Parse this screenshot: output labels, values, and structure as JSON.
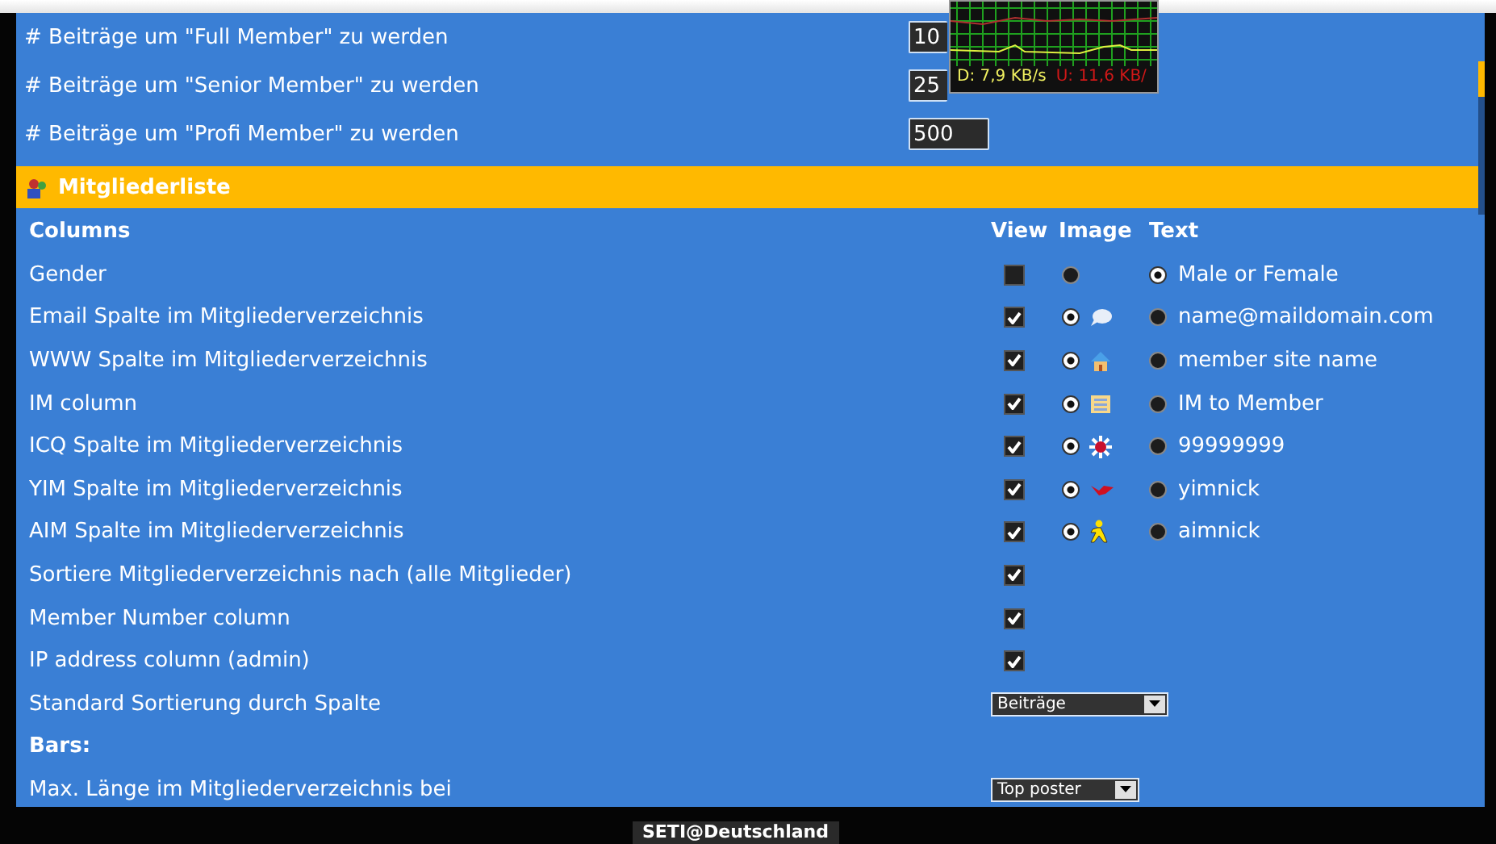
{
  "settings": [
    {
      "label": "# Beiträge um \"Full Member\" zu werden",
      "value": "10"
    },
    {
      "label": "# Beiträge um \"Senior Member\" zu werden",
      "value": "25"
    },
    {
      "label": "# Beiträge um \"Profi Member\" zu werden",
      "value": "500"
    }
  ],
  "network_monitor": {
    "download": "D: 7,9 KB/s",
    "upload": "U: 11,6 KB/"
  },
  "section": {
    "title": "Mitgliederliste"
  },
  "table": {
    "columns": [
      "Columns",
      "View",
      "Image",
      "Text"
    ],
    "rows": [
      {
        "kind": "options",
        "label": "Gender",
        "view_checked": false,
        "image_selected": false,
        "text_selected": true,
        "text": "Male or Female"
      },
      {
        "kind": "options",
        "label": "Email Spalte im Mitgliederverzeichnis",
        "view_checked": true,
        "image_selected": true,
        "text_selected": false,
        "text": "name@maildomain.com"
      },
      {
        "kind": "options",
        "label": "WWW Spalte im Mitgliederverzeichnis",
        "view_checked": true,
        "image_selected": true,
        "text_selected": false,
        "text": "member site name"
      },
      {
        "kind": "options",
        "label": "IM column",
        "view_checked": true,
        "image_selected": true,
        "text_selected": false,
        "text": "IM to Member"
      },
      {
        "kind": "options",
        "label": "ICQ Spalte im Mitgliederverzeichnis",
        "view_checked": true,
        "image_selected": true,
        "text_selected": false,
        "text": "99999999"
      },
      {
        "kind": "options",
        "label": "YIM Spalte im Mitgliederverzeichnis",
        "view_checked": true,
        "image_selected": true,
        "text_selected": false,
        "text": "yimnick"
      },
      {
        "kind": "options",
        "label": "AIM Spalte im Mitgliederverzeichnis",
        "view_checked": true,
        "image_selected": true,
        "text_selected": false,
        "text": "aimnick"
      },
      {
        "kind": "checkbox",
        "label": "Sortiere Mitgliederverzeichnis nach (alle Mitglieder)",
        "view_checked": true
      },
      {
        "kind": "checkbox",
        "label": "Member Number column",
        "view_checked": true
      },
      {
        "kind": "checkbox",
        "label": "IP address column (admin)",
        "view_checked": true
      },
      {
        "kind": "select",
        "label": "Standard Sortierung durch Spalte",
        "value": "Beiträge"
      },
      {
        "kind": "heading",
        "label": "Bars:"
      },
      {
        "kind": "select",
        "label": "Max. Länge im Mitgliederverzeichnis bei",
        "value": "Top poster"
      }
    ]
  },
  "footer": {
    "logo": "SETI@Deutschland"
  }
}
